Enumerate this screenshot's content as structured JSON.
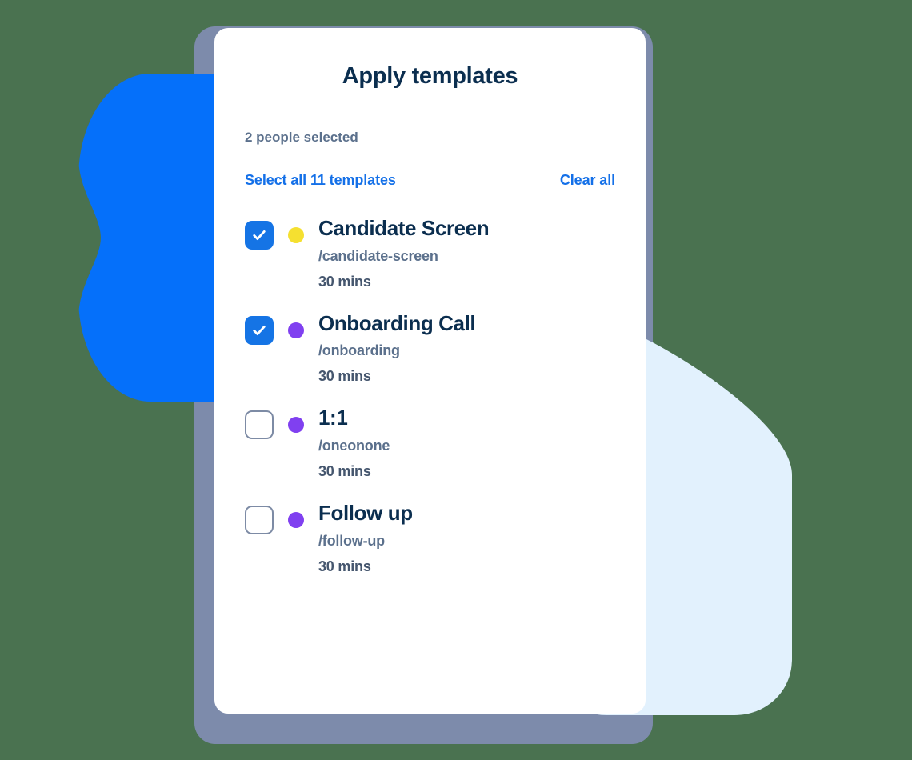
{
  "background": {
    "page_color": "#4a7250",
    "blob_color": "#0570fa",
    "light_panel_color": "#e2f1fd",
    "backdrop_color": "#7d8bab"
  },
  "card": {
    "title": "Apply templates",
    "selection_summary": "2 people selected",
    "select_all_label": "Select all 11 templates",
    "clear_all_label": "Clear all",
    "accent_color": "#1470e8",
    "checkbox_checked_color": "#1574e5",
    "templates": [
      {
        "name": "Candidate Screen",
        "slug": "/candidate-screen",
        "duration": "30 mins",
        "checked": true,
        "dot_color": "#f5e030"
      },
      {
        "name": "Onboarding Call",
        "slug": "/onboarding",
        "duration": "30 mins",
        "checked": true,
        "dot_color": "#8040f0"
      },
      {
        "name": "1:1",
        "slug": "/oneonone",
        "duration": "30 mins",
        "checked": false,
        "dot_color": "#8040f0"
      },
      {
        "name": "Follow up",
        "slug": "/follow-up",
        "duration": "30 mins",
        "checked": false,
        "dot_color": "#8040f0"
      }
    ]
  }
}
